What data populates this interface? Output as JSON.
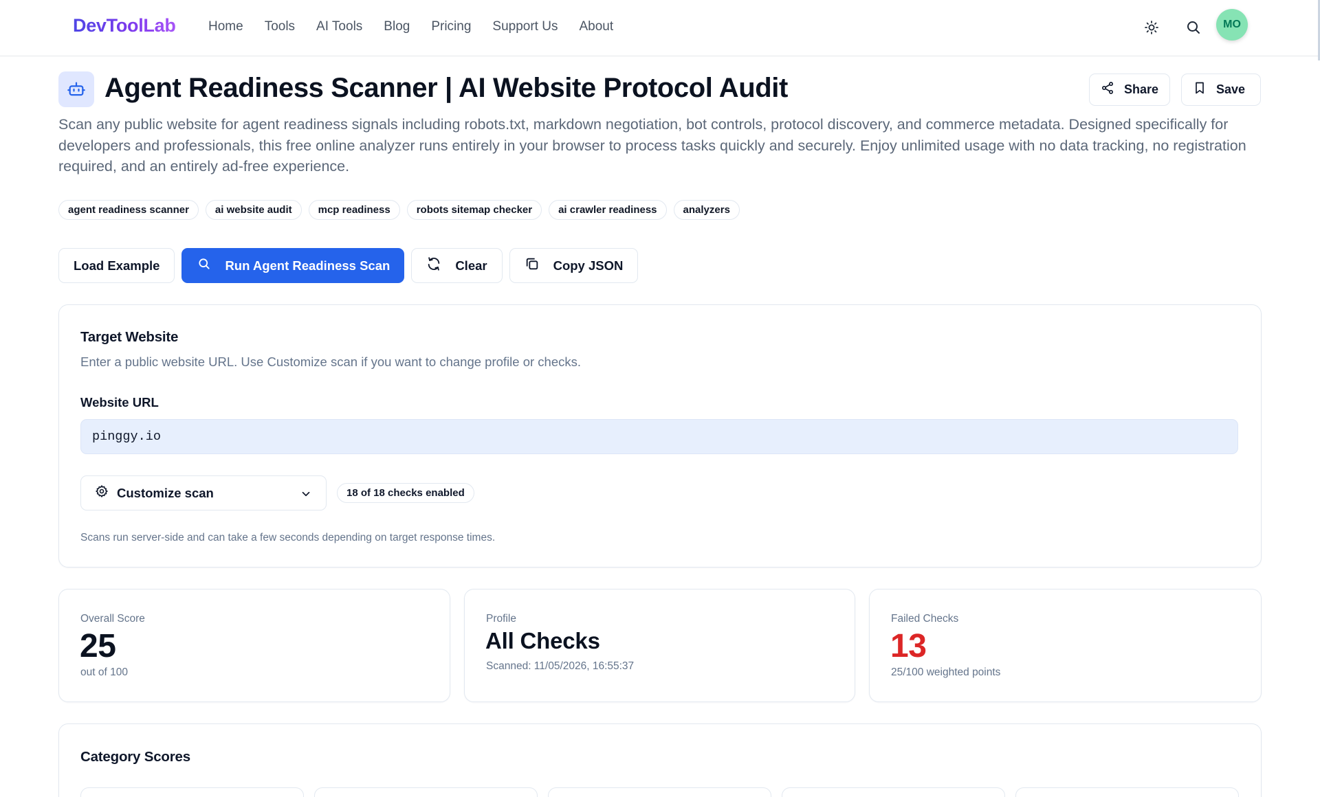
{
  "header": {
    "logo": "DevToolLab",
    "nav": [
      "Home",
      "Tools",
      "AI Tools",
      "Blog",
      "Pricing",
      "Support Us",
      "About"
    ],
    "avatar_initials": "MO"
  },
  "page": {
    "title": "Agent Readiness Scanner | AI Website Protocol Audit",
    "share_label": "Share",
    "save_label": "Save",
    "description": "Scan any public website for agent readiness signals including robots.txt, markdown negotiation, bot controls, protocol discovery, and commerce metadata. Designed specifically for developers and professionals, this free online analyzer runs entirely in your browser to process tasks quickly and securely. Enjoy unlimited usage with no data tracking, no registration required, and an entirely ad-free experience.",
    "tags": [
      "agent readiness scanner",
      "ai website audit",
      "mcp readiness",
      "robots sitemap checker",
      "ai crawler readiness",
      "analyzers"
    ]
  },
  "actions": {
    "load_example": "Load Example",
    "run_scan": "Run Agent Readiness Scan",
    "clear": "Clear",
    "copy_json": "Copy JSON"
  },
  "target": {
    "title": "Target Website",
    "subtitle": "Enter a public website URL. Use Customize scan if you want to change profile or checks.",
    "url_label": "Website URL",
    "url_value": "pinggy.io",
    "customize_label": "Customize scan",
    "checks_pill": "18 of 18 checks enabled",
    "note": "Scans run server-side and can take a few seconds depending on target response times."
  },
  "stats": {
    "overall": {
      "label": "Overall Score",
      "value": "25",
      "sub": "out of 100"
    },
    "profile": {
      "label": "Profile",
      "value": "All Checks",
      "sub": "Scanned: 11/05/2026, 16:55:37"
    },
    "failed": {
      "label": "Failed Checks",
      "value": "13",
      "sub": "25/100 weighted points",
      "color": "#dc2626"
    }
  },
  "category": {
    "title": "Category Scores"
  },
  "colors": {
    "primary": "#2563eb",
    "danger": "#dc2626"
  },
  "icons": {
    "theme": "sun-icon",
    "search": "search-icon",
    "bot": "bot-icon",
    "share": "share-icon",
    "save": "bookmark-icon",
    "clear": "refresh-icon",
    "copy": "copy-icon",
    "settings": "gear-icon",
    "dropdown": "chevron-down-icon"
  }
}
